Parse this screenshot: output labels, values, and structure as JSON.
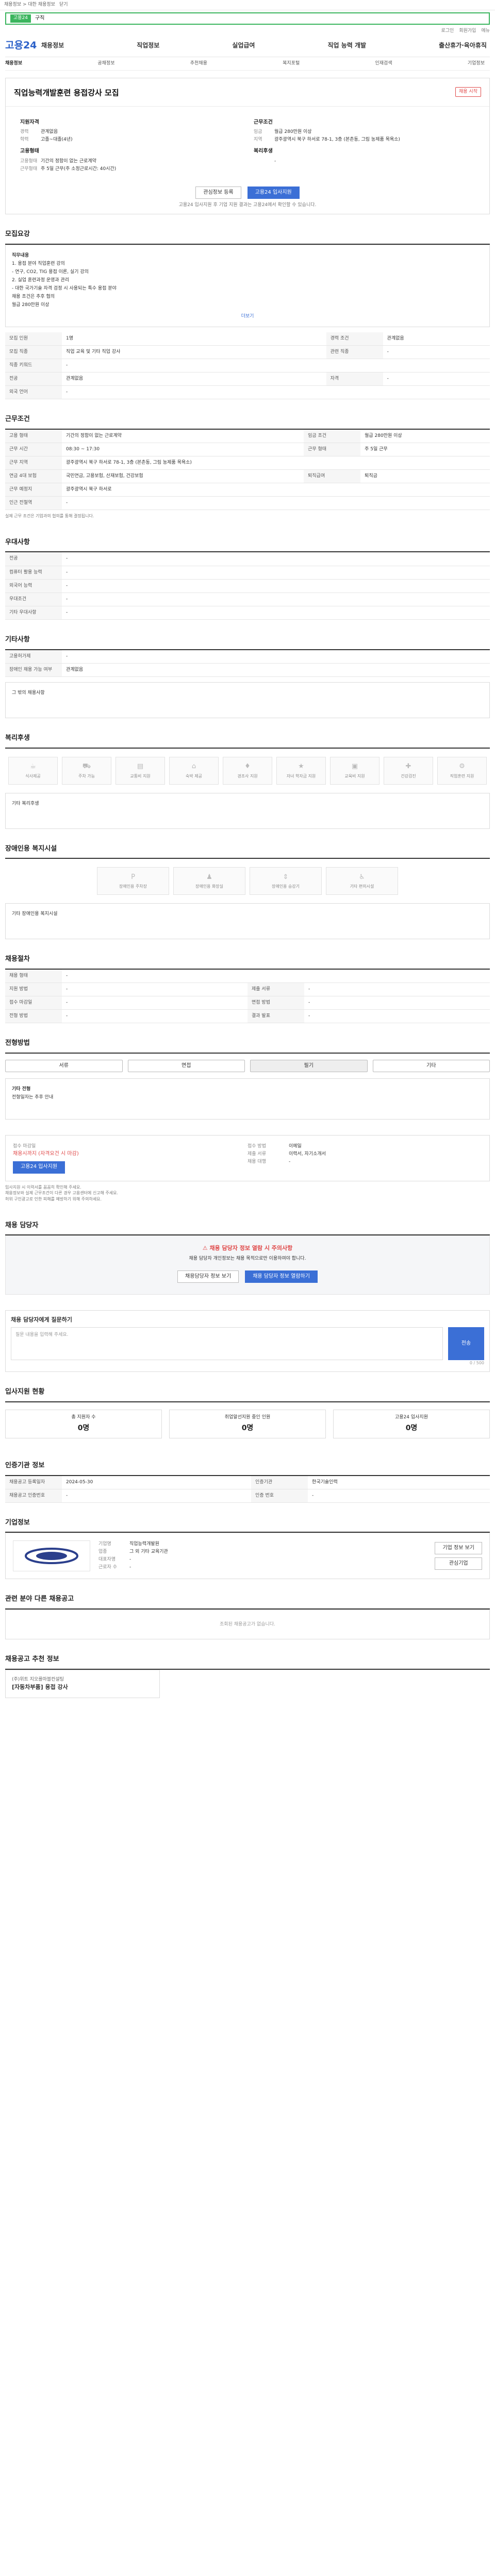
{
  "topbar": {
    "links": [
      "채용정보 > 대한 채용정보",
      "닫기"
    ]
  },
  "urlbar": {
    "tag": "고용24",
    "text": "구직"
  },
  "util": [
    "로그인",
    "회원가입",
    "메뉴"
  ],
  "gnb": {
    "logo": "고용24",
    "menu": [
      "채용정보",
      "직업정보",
      "실업급여",
      "직업 능력 개발",
      "출산휴가·육아휴직"
    ]
  },
  "snb": {
    "home": "채용정보",
    "items": [
      "공채정보",
      "추천채용",
      "복지포털",
      "인재검색",
      "기업정보"
    ]
  },
  "job": {
    "company": "",
    "title": "직업능력개발훈련 용접강사 모집",
    "badge": "채용 시작",
    "cols": [
      {
        "title": "지원자격",
        "rows": [
          [
            "경력",
            "관계없음"
          ],
          [
            "학력",
            "고졸~대졸(4년)"
          ]
        ]
      },
      {
        "title": "근무조건",
        "rows": [
          [
            "임금",
            "월급 280만원 이상"
          ],
          [
            "지역",
            "광주광역시 북구 하서로 78-1, 3층 (본촌동, 그림 농제품 목욕소)"
          ]
        ]
      },
      {
        "title": "고용형태",
        "rows": [
          [
            "고용형태",
            "기간의 정함이 없는 근로계약"
          ],
          [
            "근무형태",
            "주 5일 근무(주 소정근로시간: 40시간)"
          ]
        ]
      },
      {
        "title": "복리후생",
        "rows": [
          [
            "",
            "-"
          ]
        ]
      }
    ],
    "btn_save": "관심정보 등록",
    "btn_apply": "고용24 입사지원",
    "note": "고용24 입사지원 후 기업 지원 결과는 고용24에서 확인할 수 있습니다."
  },
  "sec1": {
    "title": "모집요강",
    "desc": [
      "직무내용",
      "1. 용접 분야 직업훈련 강의",
      "- 연구, CO2, TIG 용접 이론, 실기 강의",
      "2. 실업 훈련과정 운영과 관리",
      "- 대한 국가기술 자격 검정 시 사용되는 특수 용접 분야",
      "",
      "채용 조건은 추후 협의",
      "월급 280만원 이상"
    ],
    "more": "더보기",
    "rows": [
      [
        "모집 인원",
        "1명",
        "경력 조건",
        "관계없음"
      ],
      [
        "모집 직종",
        "직업 교육 및 기타 직업 강사",
        "관련 직종",
        "-"
      ],
      [
        "직종 키워드",
        "-",
        "",
        ""
      ],
      [
        "전공",
        "관계없음",
        "자격",
        "-"
      ],
      [
        "외국 언어",
        "-",
        "",
        ""
      ]
    ]
  },
  "sec2": {
    "title": "근무조건",
    "rows": [
      [
        "고용 형태",
        "기간의 정함이 없는 근로계약",
        "임금 조건",
        "월급 280만원 이상"
      ],
      [
        "근무 시간",
        "08:30 ~ 17:30",
        "근무 형태",
        "주 5일 근무"
      ],
      [
        "근무 지역",
        "광주광역시 북구 하서로 78-1, 3층 (본촌동, 그림 농제품 목욕소)",
        "",
        ""
      ],
      [
        "연금 4대 보험",
        "국민연금, 고용보험, 산재보험, 건강보험",
        "퇴직급여",
        "퇴직금"
      ],
      [
        "근무 예정지",
        "광주광역시 북구 하서로",
        "",
        ""
      ],
      [
        "인근 전철역",
        "-",
        "",
        ""
      ]
    ],
    "note": "실제 근무 조건은 기업과의 협의를 통해 결정됩니다."
  },
  "sec3": {
    "title": "우대사항",
    "rows": [
      [
        "전공",
        "-"
      ],
      [
        "컴퓨터 활용 능력",
        "-"
      ],
      [
        "외국어 능력",
        "-"
      ],
      [
        "우대조건",
        "-"
      ],
      [
        "기타 우대사항",
        "-"
      ]
    ]
  },
  "sec4": {
    "title": "기타사항",
    "rows": [
      [
        "고용허가제",
        "-"
      ],
      [
        "장애인 채용 가능 여부",
        "관계없음"
      ]
    ],
    "extra": "그 밖의 채용사항"
  },
  "sec5": {
    "title": "복리후생",
    "icons": [
      "식사제공",
      "주차 가능",
      "교통비 지원",
      "숙박 제공",
      "경조사 지원",
      "자녀 학자금 지원",
      "교육비 지원",
      "건강검진",
      "직업훈련 지원"
    ],
    "extra": "기타 복리후생"
  },
  "sec6": {
    "title": "장애인용 복지시설",
    "icons": [
      "장애인용 주차장",
      "장애인용 화장실",
      "장애인용 승강기",
      "기타 편의시설"
    ],
    "extra": "기타 장애인용 복지시설"
  },
  "sec7": {
    "title": "채용절차",
    "rows": [
      [
        "채용 형태",
        "-",
        "",
        ""
      ],
      [
        "지원 방법",
        "-",
        "제출 서류",
        "-"
      ],
      [
        "접수 마감일",
        "-",
        "면접 방법",
        "-"
      ],
      [
        "전형 방법",
        "-",
        "결과 발표",
        "-"
      ]
    ]
  },
  "sec8": {
    "title": "전형방법",
    "tabs": [
      "서류",
      "면접",
      "필기",
      "기타"
    ],
    "extra": "기타 전형",
    "extra_val": "전형일자는 추후 안내"
  },
  "sec9": {
    "rows": [
      [
        "접수 마감일",
        "채용시까지 (자격요건 시 마감)",
        "접수 방법",
        "이메일"
      ],
      [
        "제출 서류",
        "이력서, 자기소개서",
        "채용 대행",
        "-"
      ]
    ],
    "btn": "고용24 입사지원",
    "notes": [
      "입사지원 시 이력서를 꼼꼼히 확인해 주세요.",
      "채용정보와 실제 근무조건이 다른 경우 고용센터에 신고해 주세요.",
      "허위 구인광고로 인한 피해를 예방하기 위해 주의하세요."
    ]
  },
  "sec10": {
    "title": "채용 담당자",
    "warn": "채용 담당자 정보 열람 시 주의사항",
    "desc": "채용 담당자 개인정보는 채용 목적으로만 이용하여야 합니다.",
    "btn1": "채용담당자 정보 보기",
    "btn2": "채용 담당자 정보 열람하기"
  },
  "sec11": {
    "label": "채용 담당자에게 질문하기",
    "placeholder": "질문 내용을 입력해 주세요.",
    "count": "0 / 500",
    "btn": "전송"
  },
  "sec12": {
    "title": "입사지원 현황",
    "cards": [
      [
        "총 지원자 수",
        "0명"
      ],
      [
        "취업알선지원 중인 인원",
        "0명"
      ],
      [
        "고용24 입사지원",
        "0명"
      ]
    ]
  },
  "sec13": {
    "title": "인증기관 정보",
    "rows": [
      [
        "채용공고 등록일자",
        "2024-05-30",
        "인증기관",
        "한국기술인력"
      ],
      [
        "채용공고 인증번호",
        "-",
        "인증 번호",
        "-"
      ]
    ]
  },
  "sec14": {
    "title": "기업정보",
    "rows": [
      [
        "기업명",
        "직업능력개발원"
      ],
      [
        "업종",
        "그 외 기타 교육기관"
      ],
      [
        "대표자명",
        "-"
      ],
      [
        "근로자 수",
        "-"
      ]
    ],
    "btn1": "기업 정보 보기",
    "btn2": "관심기업"
  },
  "sec15": {
    "title": "관련 분야 다른 채용공고",
    "empty": "조회된 채용공고가 없습니다."
  },
  "sec16": {
    "title": "채용공고 추천 정보",
    "company": "(주)위트 지오를마블컨설팅",
    "job": "[자동차부품] 용접 강사"
  }
}
